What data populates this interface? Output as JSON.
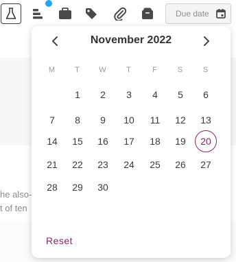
{
  "toolbar": {
    "due_date_placeholder": "Due date",
    "notification_color": "#1ea7f3",
    "icons": [
      "flask-icon",
      "stack-icon",
      "briefcase-icon",
      "tag-icon",
      "paperclip-icon",
      "box-icon",
      "calendar-icon"
    ]
  },
  "background": {
    "lines": [
      "he also-",
      "t of ten"
    ]
  },
  "calendar": {
    "month_title": "November 2022",
    "weekdays": [
      "M",
      "T",
      "W",
      "T",
      "F",
      "S",
      "S"
    ],
    "weeks": [
      [
        "",
        "1",
        "2",
        "3",
        "4",
        "5",
        "6"
      ],
      [
        "7",
        "8",
        "9",
        "10",
        "11",
        "12",
        "13"
      ],
      [
        "14",
        "15",
        "16",
        "17",
        "18",
        "19",
        "20"
      ],
      [
        "21",
        "22",
        "23",
        "24",
        "25",
        "26",
        "27"
      ],
      [
        "28",
        "29",
        "30",
        "",
        "",
        "",
        ""
      ]
    ],
    "today": "20",
    "accent_color": "#8c2372",
    "reset_label": "Reset"
  }
}
